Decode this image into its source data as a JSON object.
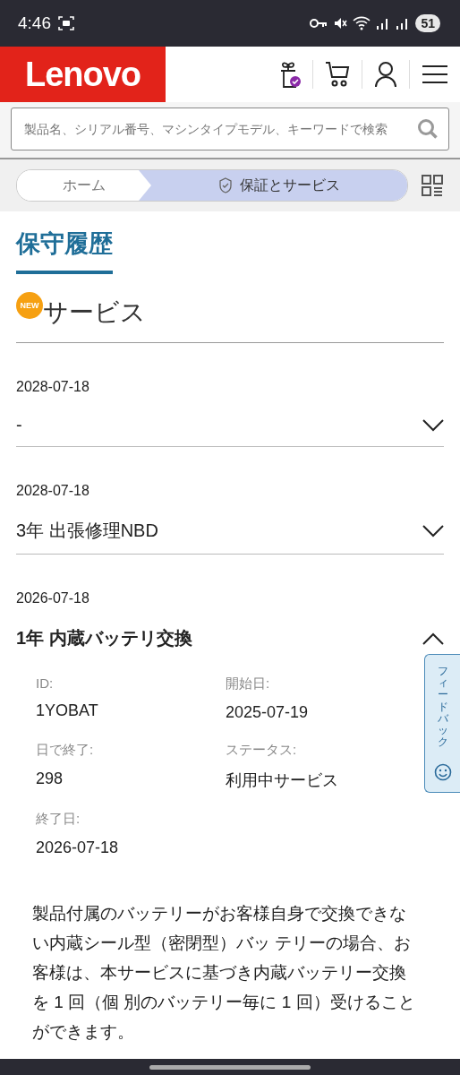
{
  "status_bar": {
    "time": "4:46",
    "battery": "51"
  },
  "header": {
    "logo": "Lenovo"
  },
  "search": {
    "placeholder": "製品名、シリアル番号、マシンタイプモデル、キーワードで検索"
  },
  "breadcrumb": [
    {
      "label": "ホーム",
      "selected": false
    },
    {
      "label": "保証とサービス",
      "selected": true
    }
  ],
  "page_title": "保守履歴",
  "section": {
    "badge": "NEW",
    "title": "サービス"
  },
  "services": [
    {
      "date": "2028-07-18",
      "title": "-",
      "expanded": false
    },
    {
      "date": "2028-07-18",
      "title": "3年 出張修理NBD",
      "expanded": false
    },
    {
      "date": "2026-07-18",
      "title": "1年 内蔵バッテリ交換",
      "expanded": true,
      "details": [
        {
          "label": "ID:",
          "value": "1YOBAT"
        },
        {
          "label": "開始日:",
          "value": "2025-07-19"
        },
        {
          "label": "日で終了:",
          "value": "298"
        },
        {
          "label": "ステータス:",
          "value": "利用中サービス"
        },
        {
          "label": "終了日:",
          "value": "2026-07-18"
        }
      ],
      "description": "製品付属のバッテリーがお客様自身で交換できない内蔵シール型（密閉型）バッ テリーの場合、お客様は、本サービスに基づき内蔵バッテリー交換を 1 回（個 別のバッテリー毎に 1 回）受けることができます。"
    }
  ],
  "feedback": {
    "label": "フィードバック"
  }
}
